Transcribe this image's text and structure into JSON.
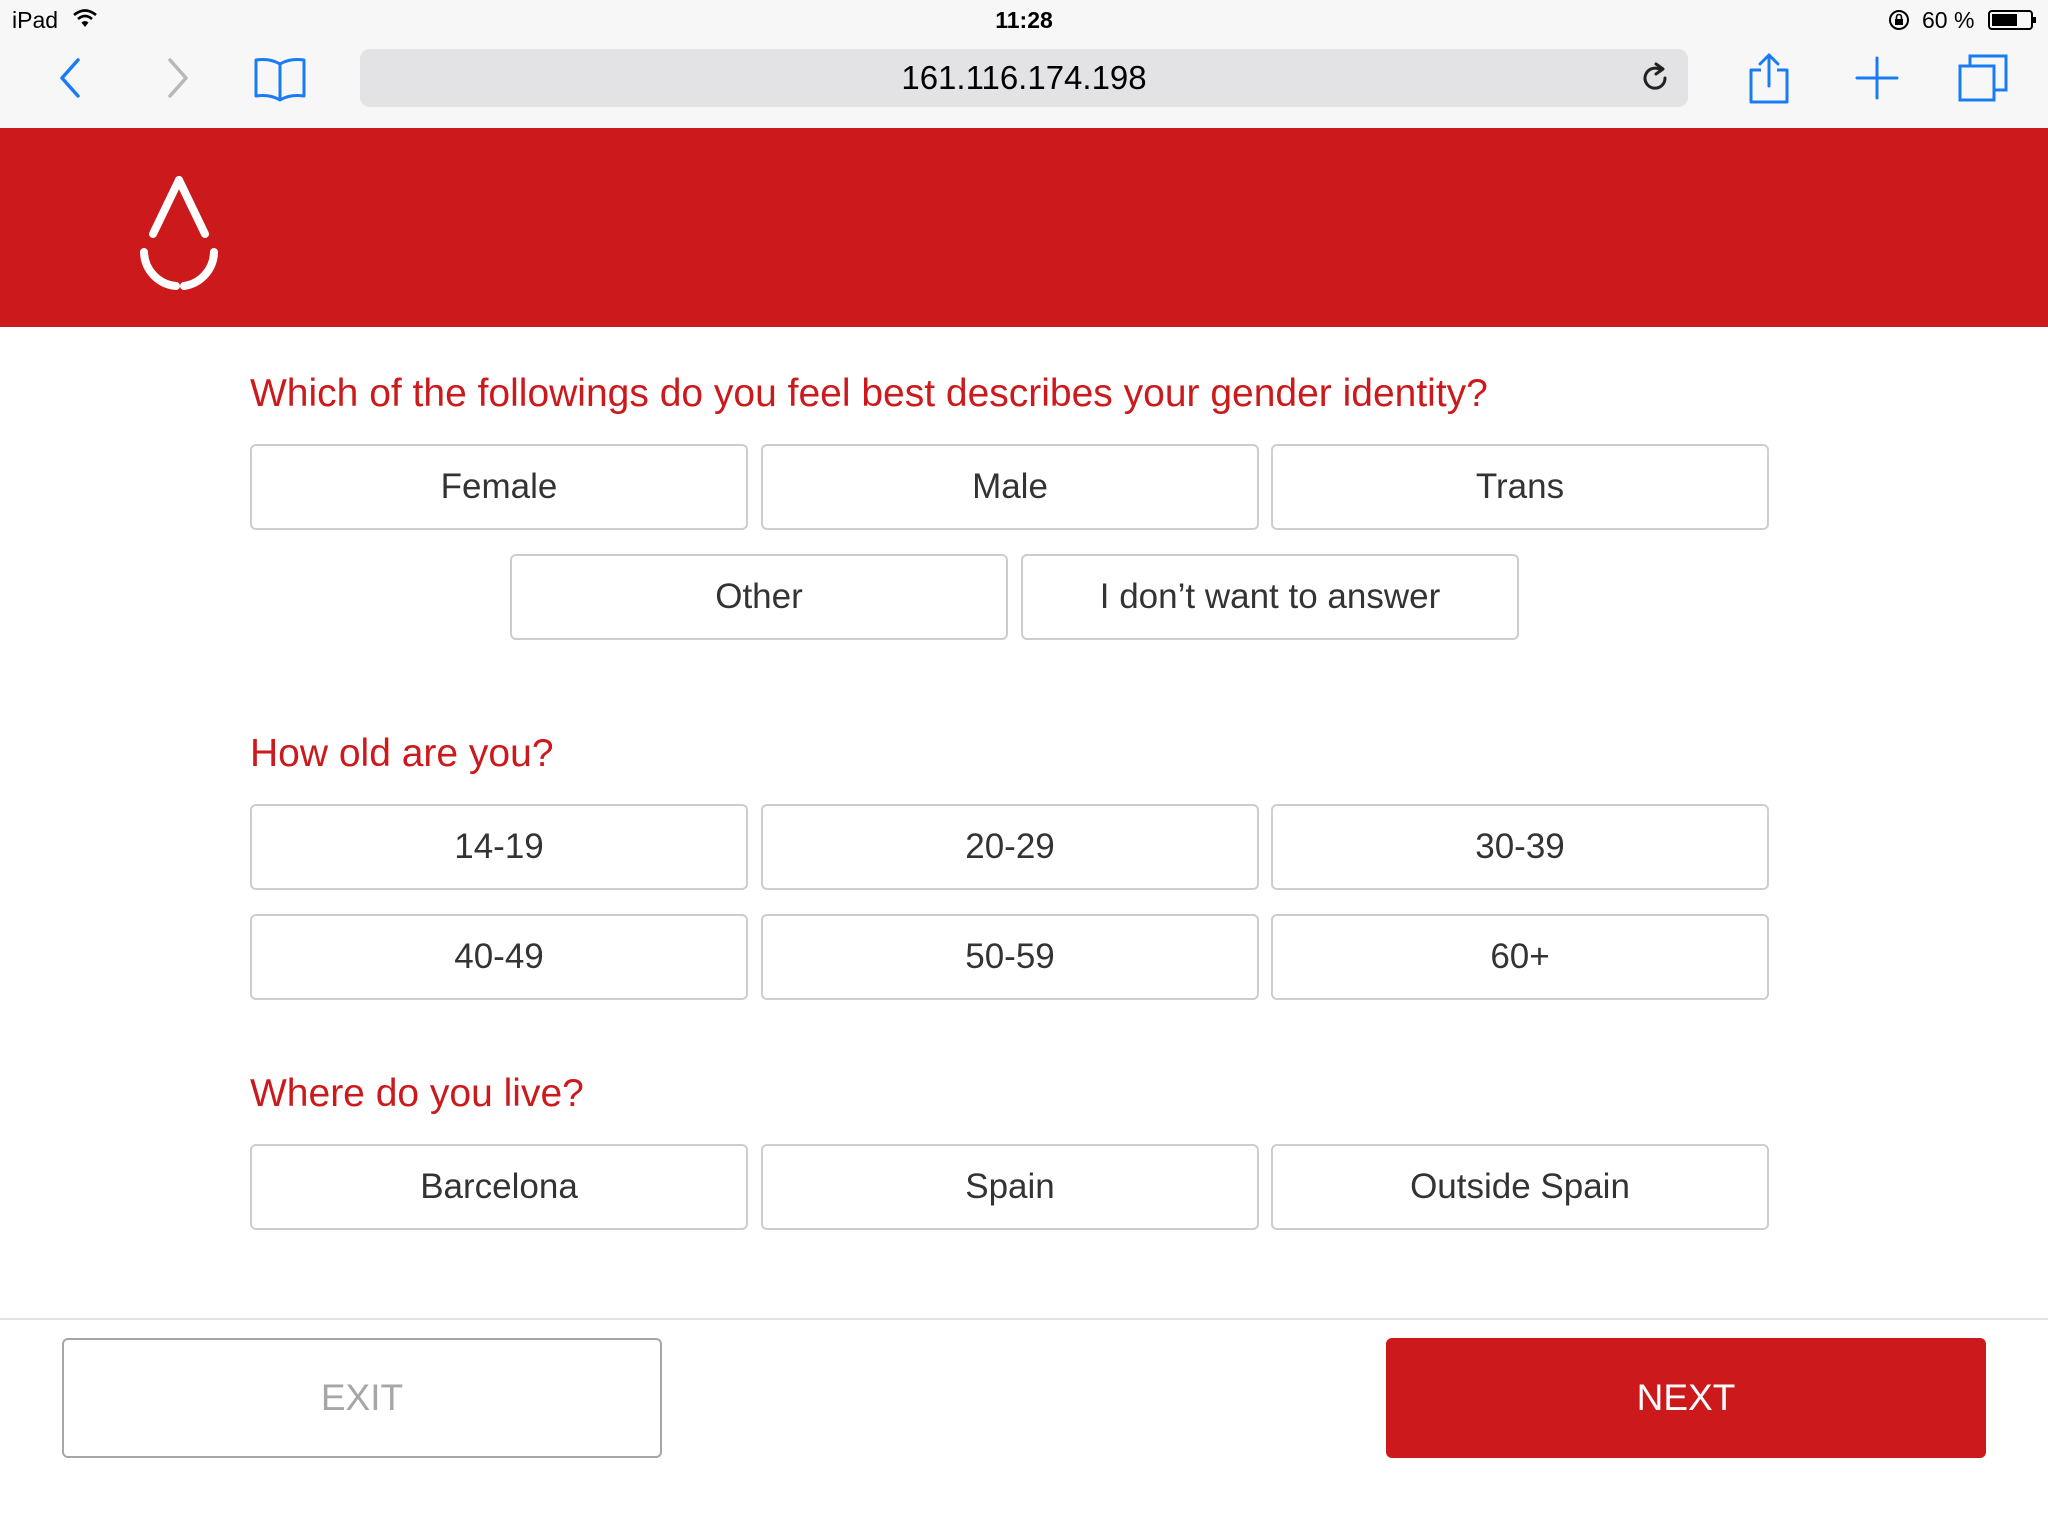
{
  "status_bar": {
    "device": "iPad",
    "time": "11:28",
    "battery": "60 %",
    "icons": [
      "wifi-icon",
      "rotation-lock-icon",
      "battery-icon"
    ]
  },
  "browser": {
    "url": "161.116.174.198",
    "icons": [
      "back-icon",
      "forward-icon",
      "bookmarks-icon",
      "reload-icon",
      "share-icon",
      "new-tab-icon",
      "tabs-icon"
    ]
  },
  "header": {
    "brand_color": "#cc1a1c",
    "logo_icon": "blood-drop-icon"
  },
  "questions": {
    "gender": {
      "title": "Which of the followings do you feel best describes your gender identity?",
      "options": [
        "Female",
        "Male",
        "Trans",
        "Other",
        "I don’t want to answer"
      ]
    },
    "age": {
      "title": "How old are you?",
      "options": [
        "14-19",
        "20-29",
        "30-39",
        "40-49",
        "50-59",
        "60+"
      ]
    },
    "location": {
      "title": "Where do you live?",
      "options": [
        "Barcelona",
        "Spain",
        "Outside Spain"
      ]
    }
  },
  "footer": {
    "exit_label": "EXIT",
    "next_label": "NEXT"
  }
}
